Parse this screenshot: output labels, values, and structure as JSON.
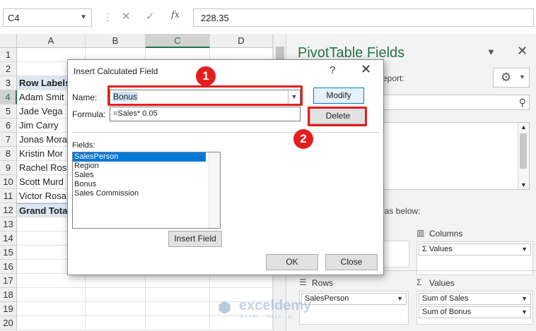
{
  "formula_bar": {
    "name_box": "C4",
    "cancel_icon": "✕",
    "enter_icon": "✓",
    "fx_label": "fx",
    "formula": "228.35"
  },
  "sheet": {
    "columns": [
      "A",
      "B",
      "C",
      "D"
    ],
    "selected_column": "C",
    "selected_row": "4",
    "rows": [
      {
        "num": "1",
        "a": ""
      },
      {
        "num": "2",
        "a": ""
      },
      {
        "num": "3",
        "a": "Row Labels"
      },
      {
        "num": "4",
        "a": "Adam Smit"
      },
      {
        "num": "5",
        "a": "Jade Vega"
      },
      {
        "num": "6",
        "a": "Jim Carry"
      },
      {
        "num": "7",
        "a": "Jonas Mora"
      },
      {
        "num": "8",
        "a": "Kristin Mor"
      },
      {
        "num": "9",
        "a": "Rachel Ross"
      },
      {
        "num": "10",
        "a": "Scott Murd"
      },
      {
        "num": "11",
        "a": "Victor Rosa"
      },
      {
        "num": "12",
        "a": "Grand Tota"
      },
      {
        "num": "13",
        "a": ""
      },
      {
        "num": "14",
        "a": ""
      },
      {
        "num": "15",
        "a": ""
      },
      {
        "num": "16",
        "a": ""
      },
      {
        "num": "17",
        "a": ""
      },
      {
        "num": "18",
        "a": ""
      },
      {
        "num": "19",
        "a": ""
      },
      {
        "num": "20",
        "a": ""
      }
    ]
  },
  "pivot_pane": {
    "title": "PivotTable Fields",
    "choose_text": "report:",
    "drag_text": "eas below:",
    "columns_label": "Columns",
    "columns_chip": "Values",
    "rows_label": "Rows",
    "rows_chip": "SalesPerson",
    "values_label": "Values",
    "values_chips": [
      "Sum of Sales",
      "Sum of Bonus"
    ],
    "sigma": "Σ"
  },
  "dialog": {
    "title": "Insert Calculated Field",
    "help": "?",
    "name_label": "Name:",
    "name_value": "Bonus",
    "formula_label": "Formula:",
    "formula_value": "=Sales* 0.05",
    "modify_label": "Modify",
    "delete_label": "Delete",
    "fields_label": "Fields:",
    "fields": [
      "SalesPerson",
      "Region",
      "Sales",
      "Bonus",
      "Sales Commission"
    ],
    "selected_field": "SalesPerson",
    "insert_field_label": "Insert Field",
    "ok_label": "OK",
    "close_label": "Close"
  },
  "callouts": {
    "step1": "1",
    "step2": "2",
    "highlight_color": "#e41e1e"
  },
  "watermark": {
    "name": "exceldemy",
    "tagline": "EXCEL · DATA · BI"
  },
  "colors": {
    "excel_green": "#217346",
    "pivot_header_fill": "#dde7f3",
    "selection_blue": "#0078d7"
  }
}
